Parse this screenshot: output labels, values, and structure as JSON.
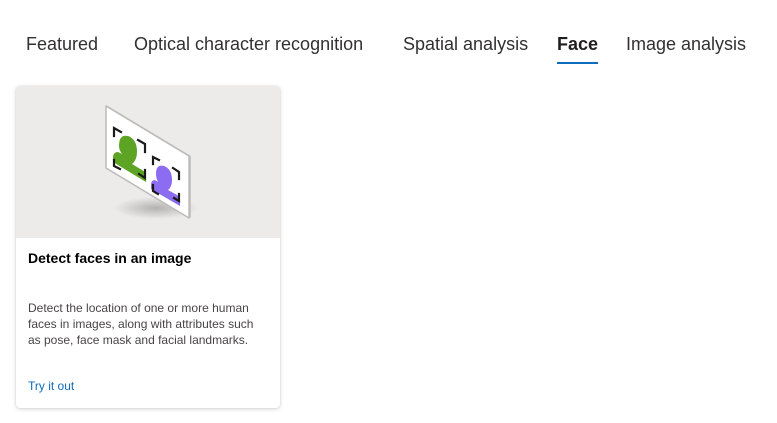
{
  "tabs": [
    {
      "label": "Featured",
      "active": false
    },
    {
      "label": "Optical character recognition",
      "active": false
    },
    {
      "label": "Spatial analysis",
      "active": false
    },
    {
      "label": "Face",
      "active": true
    },
    {
      "label": "Image analysis",
      "active": false
    }
  ],
  "card": {
    "title": "Detect faces in an image",
    "description": "Detect the location of one or more human faces in images, along with attributes such as pose, face mask and facial landmarks.",
    "link_label": "Try it out",
    "icon": "face-detection-illustration"
  },
  "colors": {
    "accent": "#0f6cbd",
    "card_image_bg": "#edebe9",
    "face_green": "#5ea424",
    "face_purple": "#8c6cf0"
  }
}
